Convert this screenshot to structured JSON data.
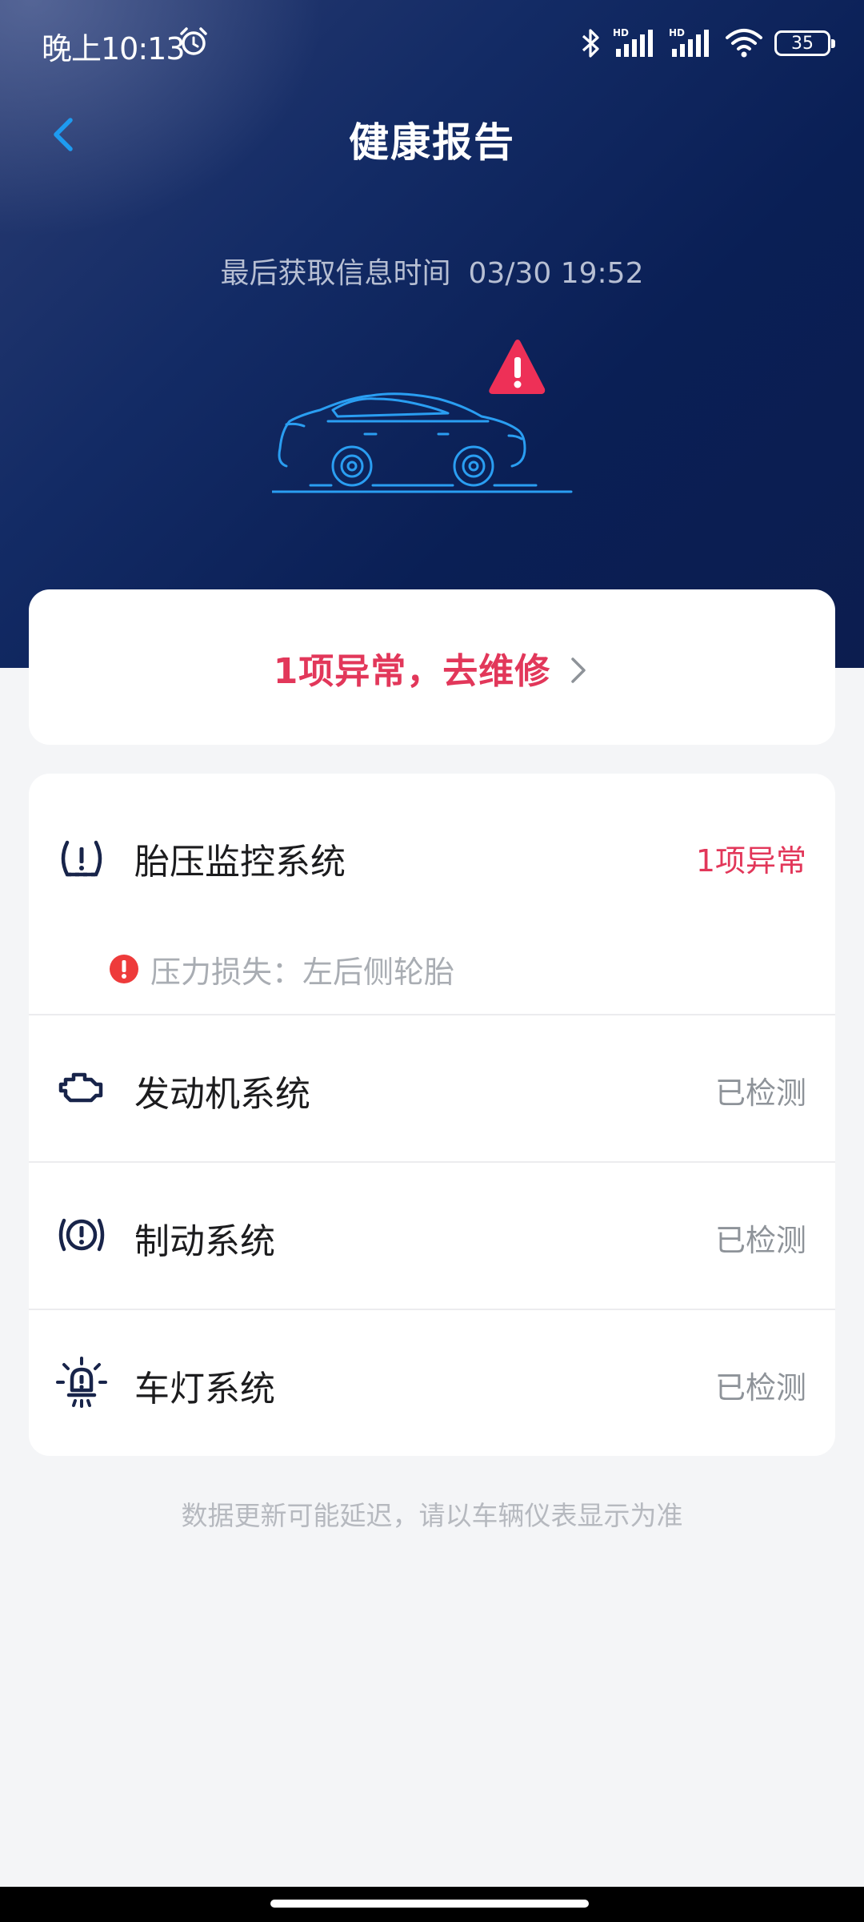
{
  "status_bar": {
    "time": "晚上10:13",
    "battery": "35",
    "signal_label_1": "HD",
    "signal_label_2": "HD"
  },
  "header": {
    "title": "健康报告",
    "update_label": "最后获取信息时间",
    "update_value": "03/30 19:52"
  },
  "summary": {
    "repair_text": "1项异常，去维修"
  },
  "systems": [
    {
      "name": "胎压监控系统",
      "status": "1项异常",
      "icon": "tire-pressure-icon",
      "fault_text": "压力损失：左后侧轮胎"
    },
    {
      "name": "发动机系统",
      "status": "已检测",
      "icon": "engine-icon"
    },
    {
      "name": "制动系统",
      "status": "已检测",
      "icon": "brake-icon"
    },
    {
      "name": "车灯系统",
      "status": "已检测",
      "icon": "light-icon"
    }
  ],
  "disclaimer": "数据更新可能延迟，请以车辆仪表显示为准",
  "colors": {
    "alert": "#e2375a",
    "accent_blue": "#1e9bf0",
    "header_bg": "#0c1d4f"
  }
}
